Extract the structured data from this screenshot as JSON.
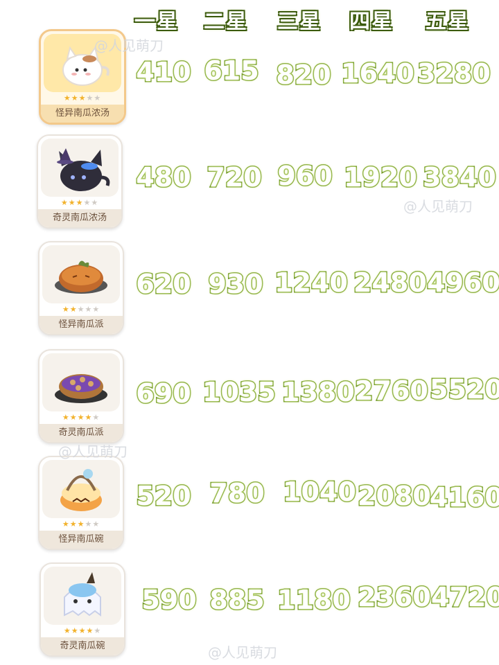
{
  "headers": [
    "一星",
    "二星",
    "三星",
    "四星",
    "五星"
  ],
  "watermark": "@人见萌刀",
  "items": [
    {
      "name": "怪异南瓜浓汤",
      "stars": 3,
      "icon": "cat-soup-bowl-icon",
      "values": [
        "410",
        "615",
        "820",
        "1640",
        "3280"
      ]
    },
    {
      "name": "奇灵南瓜浓汤",
      "stars": 3,
      "icon": "witch-cat-pot-icon",
      "values": [
        "480",
        "720",
        "960",
        "1920",
        "3840"
      ]
    },
    {
      "name": "怪异南瓜派",
      "stars": 2,
      "icon": "pumpkin-pie-icon",
      "values": [
        "620",
        "930",
        "1240",
        "2480",
        "4960"
      ]
    },
    {
      "name": "奇灵南瓜派",
      "stars": 4,
      "icon": "blueberry-pie-icon",
      "values": [
        "690",
        "1035",
        "1380",
        "2760",
        "5520"
      ]
    },
    {
      "name": "怪异南瓜碗",
      "stars": 3,
      "icon": "pumpkin-bowl-icon",
      "values": [
        "520",
        "780",
        "1040",
        "2080",
        "4160"
      ]
    },
    {
      "name": "奇灵南瓜碗",
      "stars": 4,
      "icon": "ghost-pumpkin-bowl-icon",
      "values": [
        "590",
        "885",
        "1180",
        "2360",
        "4720"
      ]
    }
  ]
}
